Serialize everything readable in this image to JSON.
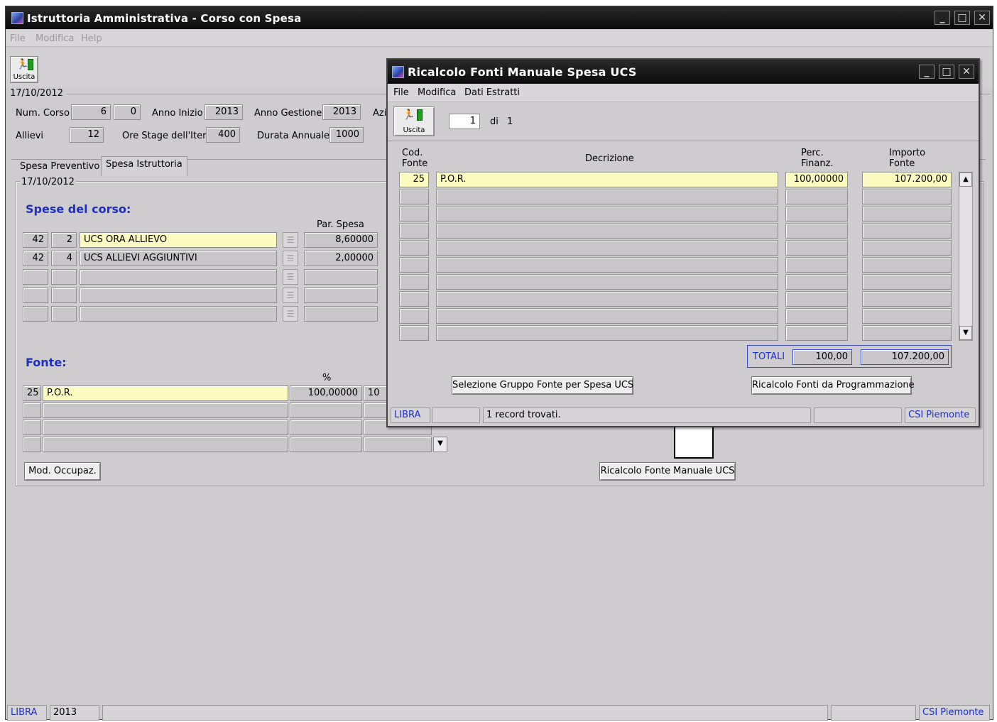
{
  "main_window": {
    "title": "Istruttoria Amministrativa - Corso con Spesa",
    "menu": [
      "File",
      "Modifica",
      "Help"
    ],
    "toolbar": {
      "exit_label": "Uscita"
    },
    "date_group": "17/10/2012",
    "fields": {
      "num_corso_label": "Num. Corso",
      "num_corso_1": "6",
      "num_corso_2": "0",
      "anno_inizio_label": "Anno Inizio",
      "anno_inizio": "2013",
      "anno_gestione_label": "Anno Gestione",
      "anno_gestione": "2013",
      "azi_label": "Azi",
      "allievi_label": "Allievi",
      "allievi": "12",
      "ore_stage_label": "Ore Stage dell'Iter",
      "ore_stage": "400",
      "durata_label": "Durata Annuale",
      "durata": "1000"
    },
    "tabs": [
      "Spesa Preventivo",
      "Spesa Istruttoria"
    ],
    "active_tab": "Spesa Istruttoria",
    "tab_date": "17/10/2012",
    "spese": {
      "title": "Spese del corso:",
      "col_par_spesa": "Par. Spesa",
      "rows": [
        {
          "c1": "42",
          "c2": "2",
          "desc": "UCS ORA ALLIEVO",
          "par": "8,60000"
        },
        {
          "c1": "42",
          "c2": "4",
          "desc": "UCS ALLIEVI AGGIUNTIVI",
          "par": "2,00000"
        },
        {
          "c1": "",
          "c2": "",
          "desc": "",
          "par": ""
        },
        {
          "c1": "",
          "c2": "",
          "desc": "",
          "par": ""
        },
        {
          "c1": "",
          "c2": "",
          "desc": "",
          "par": ""
        }
      ]
    },
    "fonte": {
      "title": "Fonte:",
      "col_pct": "%",
      "rows": [
        {
          "cod": "25",
          "desc": "P.O.R.",
          "pct": "100,00000",
          "extra": "10"
        },
        {
          "cod": "",
          "desc": "",
          "pct": "",
          "extra": ""
        },
        {
          "cod": "",
          "desc": "",
          "pct": "",
          "extra": ""
        },
        {
          "cod": "",
          "desc": "",
          "pct": "",
          "extra": ""
        }
      ]
    },
    "mod_occupaz_label": "Mod. Occupaz.",
    "ricalcolo_manuale_label": "Ricalcolo Fonte Manuale UCS",
    "status": {
      "app": "LIBRA",
      "year": "2013",
      "company": "CSI Piemonte"
    }
  },
  "dialog": {
    "title": "Ricalcolo Fonti Manuale Spesa UCS",
    "menu": [
      "File",
      "Modifica",
      "Dati Estratti"
    ],
    "exit_label": "Uscita",
    "record_current": "1",
    "record_of": "di",
    "record_total": "1",
    "headers": {
      "cod_fonte": "Cod.\nFonte",
      "decrizione": "Decrizione",
      "perc_finanz": "Perc.\nFinanz.",
      "importo_fonte": "Importo\nFonte"
    },
    "rows": [
      {
        "cod": "25",
        "desc": "P.O.R.",
        "perc": "100,00000",
        "importo": "107.200,00"
      },
      {
        "cod": "",
        "desc": "",
        "perc": "",
        "importo": ""
      },
      {
        "cod": "",
        "desc": "",
        "perc": "",
        "importo": ""
      },
      {
        "cod": "",
        "desc": "",
        "perc": "",
        "importo": ""
      },
      {
        "cod": "",
        "desc": "",
        "perc": "",
        "importo": ""
      },
      {
        "cod": "",
        "desc": "",
        "perc": "",
        "importo": ""
      },
      {
        "cod": "",
        "desc": "",
        "perc": "",
        "importo": ""
      },
      {
        "cod": "",
        "desc": "",
        "perc": "",
        "importo": ""
      },
      {
        "cod": "",
        "desc": "",
        "perc": "",
        "importo": ""
      },
      {
        "cod": "",
        "desc": "",
        "perc": "",
        "importo": ""
      }
    ],
    "totali_label": "TOTALI",
    "totali_perc": "100,00",
    "totali_importo": "107.200,00",
    "btn_selezione": "Selezione Gruppo Fonte per Spesa UCS",
    "btn_ricalcolo_prog": "Ricalcolo Fonti da Programmazione",
    "status": {
      "app": "LIBRA",
      "message": "1 record trovati.",
      "company": "CSI Piemonte"
    }
  }
}
